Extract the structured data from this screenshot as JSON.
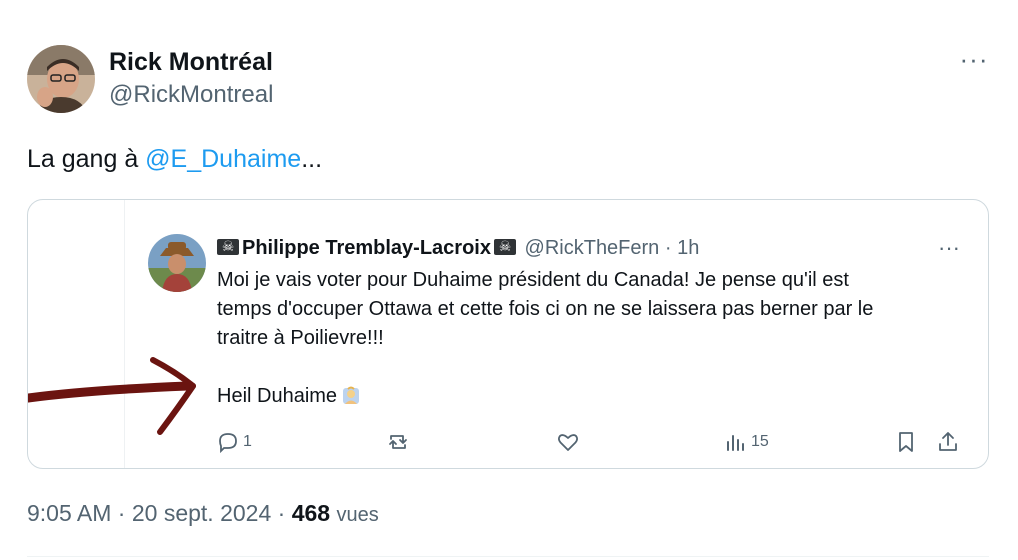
{
  "author": {
    "name": "Rick Montréal",
    "handle": "@RickMontreal",
    "avatar_icon": "profile-photo"
  },
  "tweet": {
    "text_before": "La gang à ",
    "mention": "@E_Duhaime",
    "text_after": "...",
    "more_icon": "more-dots-icon"
  },
  "quoted": {
    "name": "Philippe Tremblay-Lacroix",
    "handle": "@RickTheFern",
    "time": "· 1h",
    "body_line1": "Moi je vais voter pour Duhaime président du Canada! Je pense qu'il est",
    "body_line2": "temps d'occuper Ottawa et cette fois ci on ne se laissera pas berner par le",
    "body_line3": "traitre à Poilievre!!!",
    "body_line4": "Heil Duhaime",
    "replies": "1",
    "views": "15",
    "name_decoration_icon": "skull-flag-icon",
    "emoji_icon": "raised-hand-emoji"
  },
  "meta": {
    "time": "9:05 AM",
    "sep": " · ",
    "date": "20 sept. 2024",
    "sep2": " · ",
    "views_count": "468",
    "views_label": "vues"
  },
  "colors": {
    "accent": "#1d9bf0",
    "secondary_text": "#536471",
    "border": "#cfd9de",
    "annotation_arrow": "#6b1410"
  }
}
